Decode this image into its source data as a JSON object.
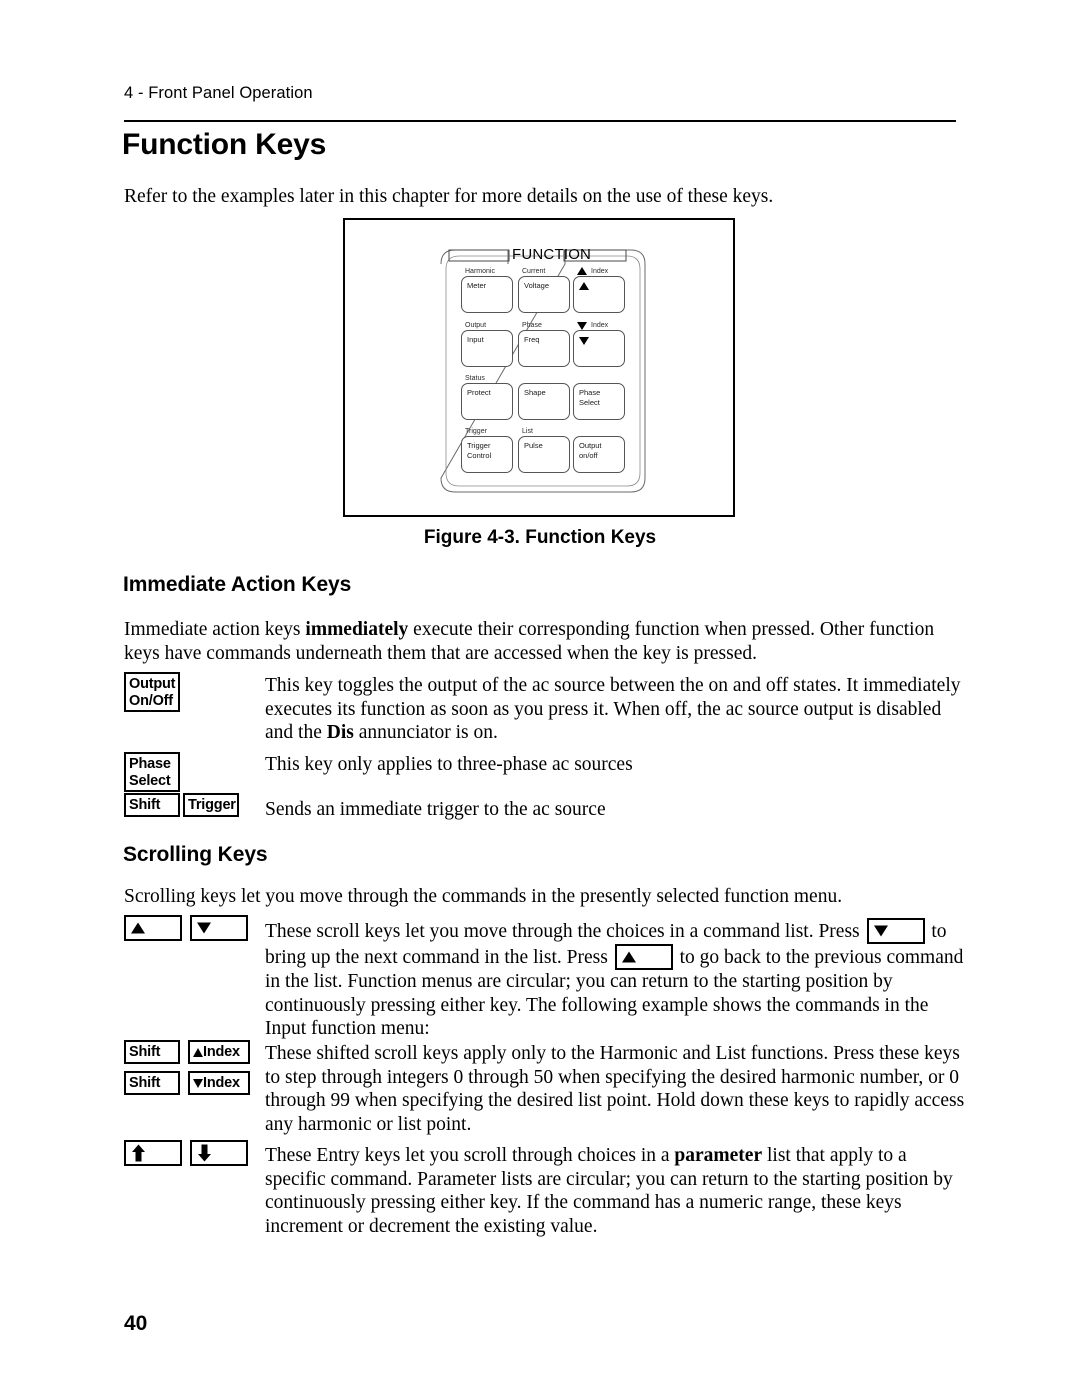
{
  "header": {
    "running_head": "4 - Front Panel Operation"
  },
  "page_number": "40",
  "sections": {
    "function_keys": {
      "title": "Function Keys",
      "intro": "Refer to the examples later in this chapter for more details on the use of these keys."
    },
    "immediate_action": {
      "title": "Immediate Action Keys",
      "para_1": "Immediate action keys ",
      "para_1_bold": "immediately",
      "para_1_rest": " execute their corresponding function when pressed. Other function keys have commands underneath them that are accessed when the key is pressed."
    },
    "scrolling": {
      "title": "Scrolling Keys",
      "para_1": "Scrolling keys let you move through the commands in the presently selected function menu."
    }
  },
  "figure": {
    "caption": "Figure 4-3. Function Keys",
    "panel_title": "FUNCTION",
    "keys": [
      {
        "shift_label": "Harmonic",
        "main_label": "Meter",
        "row": 0,
        "col": 0
      },
      {
        "shift_label": "Current",
        "main_label": "Voltage",
        "row": 0,
        "col": 1
      },
      {
        "shift_label": "Index",
        "main_label": "",
        "row": 0,
        "col": 2,
        "arrow": "up"
      },
      {
        "shift_label": "Output",
        "main_label": "Input",
        "row": 1,
        "col": 0
      },
      {
        "shift_label": "Phase",
        "main_label": "Freq",
        "row": 1,
        "col": 1
      },
      {
        "shift_label": "Index",
        "main_label": "",
        "row": 1,
        "col": 2,
        "arrow": "down"
      },
      {
        "shift_label": "Status",
        "main_label": "Protect",
        "row": 2,
        "col": 0
      },
      {
        "shift_label": "",
        "main_label": "Shape",
        "row": 2,
        "col": 1
      },
      {
        "shift_label": "",
        "main_label": "Phase\nSelect",
        "row": 2,
        "col": 2
      },
      {
        "shift_label": "Trigger",
        "main_label": "Trigger\nControl",
        "row": 3,
        "col": 0
      },
      {
        "shift_label": "List",
        "main_label": "Pulse",
        "row": 3,
        "col": 1
      },
      {
        "shift_label": "",
        "main_label": "Output\non/off",
        "row": 3,
        "col": 2
      }
    ]
  },
  "immediate_rows": [
    {
      "keys": [
        {
          "type": "text",
          "lines": [
            "Output",
            "On/Off"
          ]
        }
      ],
      "description": "This key toggles the output of the ac source between the on and off states. It immediately executes its function as soon as you press it. When off, the ac source output is disabled and the ",
      "description_bold": "Dis",
      "description_rest": " annunciator is on."
    },
    {
      "keys": [
        {
          "type": "text",
          "lines": [
            "Phase",
            "Select"
          ]
        }
      ],
      "description": "This key only applies to three-phase ac sources"
    },
    {
      "keys": [
        {
          "type": "text",
          "lines": [
            "Shift"
          ]
        },
        {
          "type": "text",
          "lines": [
            "Trigger"
          ]
        }
      ],
      "description": "Sends an immediate trigger to the ac source"
    }
  ],
  "scroll_rows": [
    {
      "keys": [
        {
          "type": "arrow",
          "direction": "up"
        },
        {
          "type": "arrow",
          "direction": "down"
        }
      ],
      "text_part_1": "These scroll keys let you move through the choices in a command list. Press ",
      "inline_key_1": "down-arrow",
      "text_part_2": " to bring up the next command in the list. Press ",
      "inline_key_2": "up-arrow",
      "text_part_3": " to go back to the previous command in the list. Function menus are circular; you can return to the starting position by continuously pressing either key. The following example shows the commands in the Input function menu:"
    },
    {
      "keys": [
        {
          "type": "text",
          "lines": [
            "Shift"
          ]
        },
        {
          "type": "index",
          "direction": "up",
          "label": "Index"
        },
        {
          "type": "text",
          "lines": [
            "Shift"
          ]
        },
        {
          "type": "index",
          "direction": "down",
          "label": "Index"
        }
      ],
      "text_part_1": "These shifted scroll keys apply only to the Harmonic and List functions. Press these keys to step through integers 0 through 50 when specifying the desired harmonic number, or 0 through 99 when specifying the desired list point. Hold down these keys to rapidly access any harmonic or list point."
    },
    {
      "keys": [
        {
          "type": "block-arrow",
          "direction": "up"
        },
        {
          "type": "block-arrow",
          "direction": "down"
        }
      ],
      "text_part_1": "These Entry keys let you scroll through choices in a ",
      "text_bold": "parameter",
      "text_part_2": " list that apply to a specific command. Parameter lists are circular; you can return to the starting position by continuously pressing either key. If the command has a numeric range, these keys increment or decrement the existing value."
    }
  ],
  "colors": {
    "ink": "#000000",
    "paper": "#ffffff",
    "diagram_line": "#555555"
  }
}
